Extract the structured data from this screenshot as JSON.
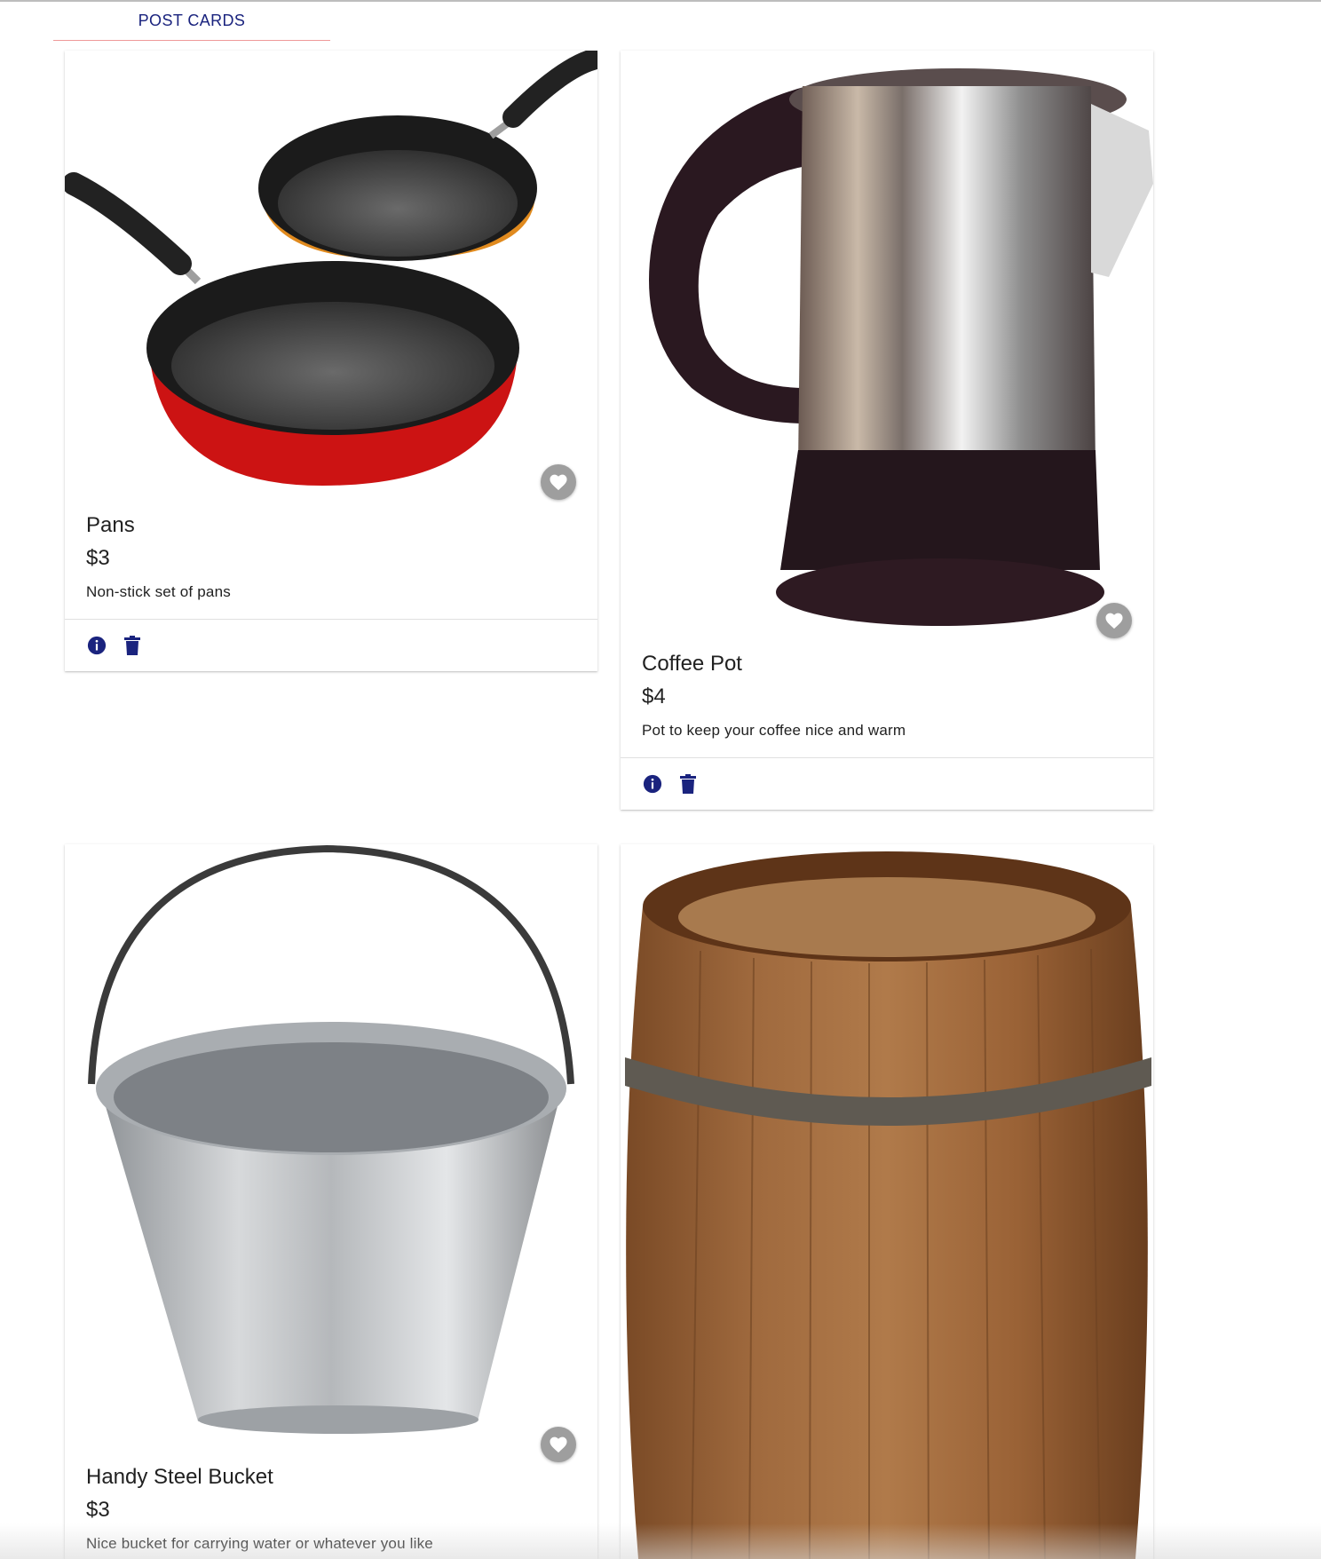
{
  "tabs": {
    "active_label": "POST CARDS"
  },
  "icons": {
    "favorite": "heart-icon",
    "info": "info-icon",
    "delete": "trash-icon"
  },
  "colors": {
    "accent": "#1a237e",
    "tab_indicator": "#ef9a9a",
    "fav_button": "#9e9e9e"
  },
  "cards": [
    {
      "title": "Pans",
      "price": "$3",
      "description": "Non-stick set of pans"
    },
    {
      "title": "Coffee Pot",
      "price": "$4",
      "description": "Pot to keep your coffee nice and warm"
    },
    {
      "title": "Handy Steel Bucket",
      "price": "$3",
      "description": "Nice bucket for carrying water or whatever you like"
    },
    {
      "title": "",
      "price": "",
      "description": ""
    }
  ]
}
